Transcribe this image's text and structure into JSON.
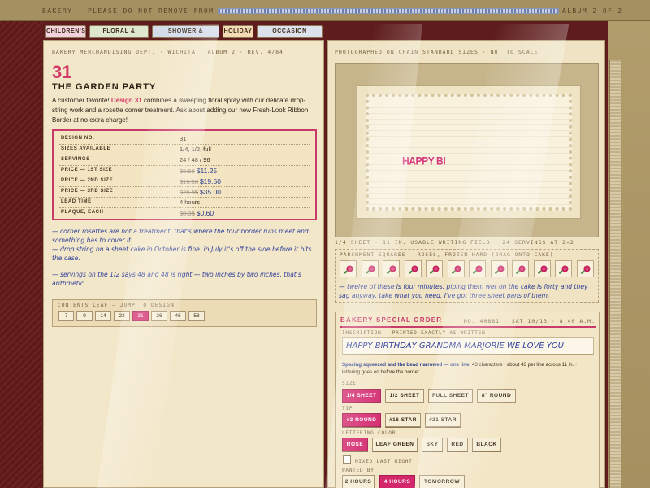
{
  "top": {
    "left_label": "BAKERY — PLEASE DO NOT REMOVE FROM COUNTER",
    "right_label": "ALBUM 2 OF 2"
  },
  "tabs": [
    {
      "label": "CHILDREN'S",
      "color": "#f2d2dd"
    },
    {
      "label": "FLORAL & SCROLL",
      "color": "#dfe8cf"
    },
    {
      "label": "SHOWER & WEDDING",
      "color": "#d4dcea"
    },
    {
      "label": "HOLIDAY",
      "color": "#f3dbb3"
    },
    {
      "label": "OCCASION PLAQUES",
      "color": "#dde2ec"
    }
  ],
  "left": {
    "dept": "BAKERY MERCHANDISING DEPT. · WICHITA · ALBUM 2 · REV. 4/84",
    "design_number": "31",
    "design_title": "THE GARDEN PARTY",
    "intro_pre": "A customer favorite! ",
    "intro_highlight": "Design 31",
    "intro_post": " combines a sweeping floral spray with our delicate drop-string work and a rosette corner treatment. Ask about adding our new Fresh-Look Ribbon Border at no extra charge!",
    "specs": [
      {
        "key": "DESIGN NO.",
        "value": "31"
      },
      {
        "key": "SIZES AVAILABLE",
        "value": "1/4, 1/2, full"
      },
      {
        "key": "SERVINGS",
        "value": "24 / 48 / 96"
      },
      {
        "key": "PRICE — 1ST SIZE",
        "old": "$9.50",
        "new": "$11.25"
      },
      {
        "key": "PRICE — 2ND SIZE",
        "old": "$16.50",
        "new": "$19.50"
      },
      {
        "key": "PRICE — 3RD SIZE",
        "old": "$29.95",
        "new": "$35.00"
      },
      {
        "key": "LEAD TIME",
        "value": "4 hours"
      },
      {
        "key": "PLAQUE, EACH",
        "old": "$0.35",
        "new": "$0.60"
      }
    ],
    "notes": [
      "— corner rosettes are not a treatment. that's where the four border runs meet and something has to cover it.",
      "— drop string on a sheet cake in October is fine. in July it's off the side before it hits the case.",
      "— servings on the 1/2 says 48 and 48 is right — two inches by two inches, that's arithmetic."
    ],
    "leaf_label": "CONTENTS LEAF — JUMP TO DESIGN",
    "pages": [
      "7",
      "9",
      "14",
      "22",
      "31",
      "36",
      "46",
      "58"
    ],
    "active_page": "31"
  },
  "right": {
    "photo_label": "PHOTOGRAPHED ON CHAIN STANDARD SIZES · NOT TO SCALE",
    "cake_writing": "HAPPY BI",
    "photo_caption": "1/4 SHEET · 11 IN. USABLE WRITING FIELD · 24 SERVINGS AT 2×2",
    "parchment_label": "PARCHMENT SQUARES — ROSES, FROZEN HARD (DRAG ONTO CAKE)",
    "rose_count": 12,
    "parchment_note": "— twelve of these is four minutes. piping them wet on the cake is forty and they sag anyway. take what you need, I've got three sheet pans of them.",
    "order": {
      "title": "BAKERY SPECIAL ORDER",
      "meta": "NO. 40881 · SAT 10/13 · 8:40 A.M.",
      "inscription_label": "INSCRIPTION — PRINTED EXACTLY AS WRITTEN",
      "inscription": "HAPPY BIRTHDAY GRANDMA MARJORIE WE LOVE YOU",
      "warn_bold": "Spacing squeezed and the bead narrowed — one line.",
      "warn_rest": " 43 characters · about 43 per line across 11 in. · lettering goes on before the border.",
      "size_label": "SIZE",
      "sizes": [
        "1/4 SHEET",
        "1/2 SHEET",
        "FULL SHEET",
        "8\" ROUND"
      ],
      "size_selected": "1/4 SHEET",
      "tip_label": "TIP",
      "tips": [
        "#3 ROUND",
        "#16 STAR",
        "#21 STAR"
      ],
      "tip_selected": "#3 ROUND",
      "color_label": "LETTERING COLOR",
      "colors": [
        "ROSE",
        "LEAF GREEN",
        "SKY",
        "RED",
        "BLACK"
      ],
      "color_selected": "ROSE",
      "mixed_label": "MIXED LAST NIGHT",
      "wanted_label": "WANTED BY",
      "wanted": [
        "2 HOURS",
        "4 HOURS",
        "TOMORROW"
      ],
      "wanted_selected": "4 HOURS"
    }
  },
  "colors": {
    "accent": "#d3266b",
    "ink_blue": "#2d3e9b",
    "binder": "#5e1c1c",
    "page": "#f3e7c9"
  }
}
